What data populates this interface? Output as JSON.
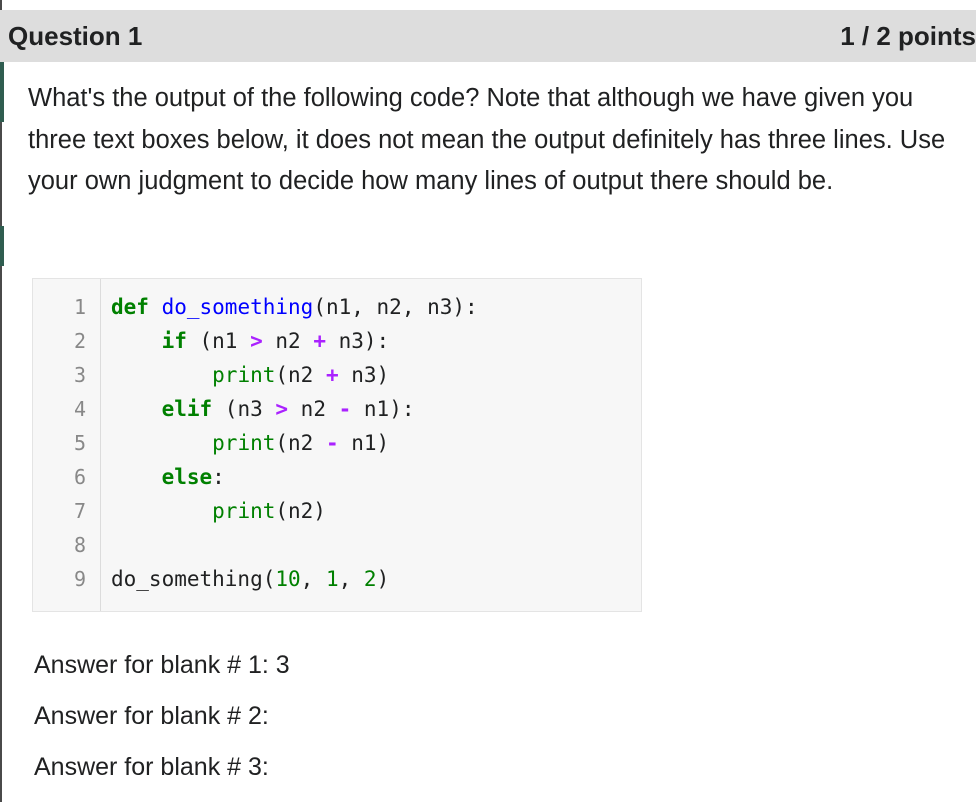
{
  "question": {
    "title": "Question 1",
    "points": "1 / 2 points",
    "prompt": "What's the output of the following code? Note that although we have given you three text boxes below, it does not mean the output definitely has three lines. Use your own judgment to decide how many lines of output there should be."
  },
  "code": {
    "line_numbers": [
      "1",
      "2",
      "3",
      "4",
      "5",
      "6",
      "7",
      "8",
      "9"
    ],
    "lines": [
      "def do_something(n1, n2, n3):",
      "    if (n1 > n2 + n3):",
      "        print(n2 + n3)",
      "    elif (n3 > n2 - n1):",
      "        print(n2 - n1)",
      "    else:",
      "        print(n2)",
      "",
      "do_something(10, 1, 2)"
    ]
  },
  "answers": [
    {
      "label": "Answer for blank # 1:",
      "value": "3"
    },
    {
      "label": "Answer for blank # 2:",
      "value": ""
    },
    {
      "label": "Answer for blank # 3:",
      "value": ""
    }
  ],
  "colors": {
    "header_bg": "#dddddd",
    "keyword": "#008000",
    "function_name": "#0000ff",
    "operator": "#aa22ff",
    "code_bg": "#f7f7f7"
  }
}
